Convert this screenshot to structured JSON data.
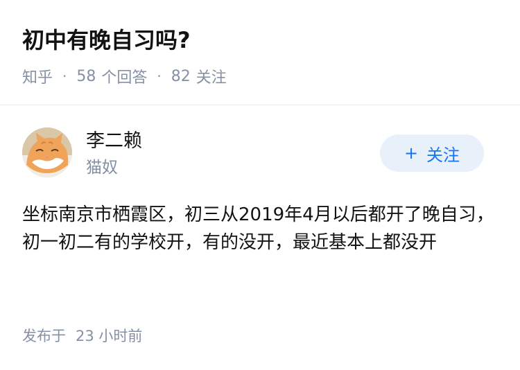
{
  "question": {
    "title": "初中有晚自习吗?",
    "source": "知乎",
    "answer_count": "58",
    "answer_count_label": "个回答",
    "follower_count": "82",
    "follower_count_label": "关注",
    "separator": "·"
  },
  "answer": {
    "author": {
      "name": "李二赖",
      "bio": "猫奴",
      "avatar_icon": "cat-avatar"
    },
    "follow_button": {
      "plus": "+",
      "label": "关注"
    },
    "content": "坐标南京市栖霞区，初三从2019年4月以后都开了晚自习，初一初二有的学校开，有的没开，最近基本上都没开",
    "footer": {
      "label": "发布于",
      "time": "23 小时前"
    }
  },
  "colors": {
    "text_primary": "#121212",
    "text_secondary": "#8590a6",
    "accent": "#1772f6",
    "button_bg": "#e8f0f9"
  }
}
